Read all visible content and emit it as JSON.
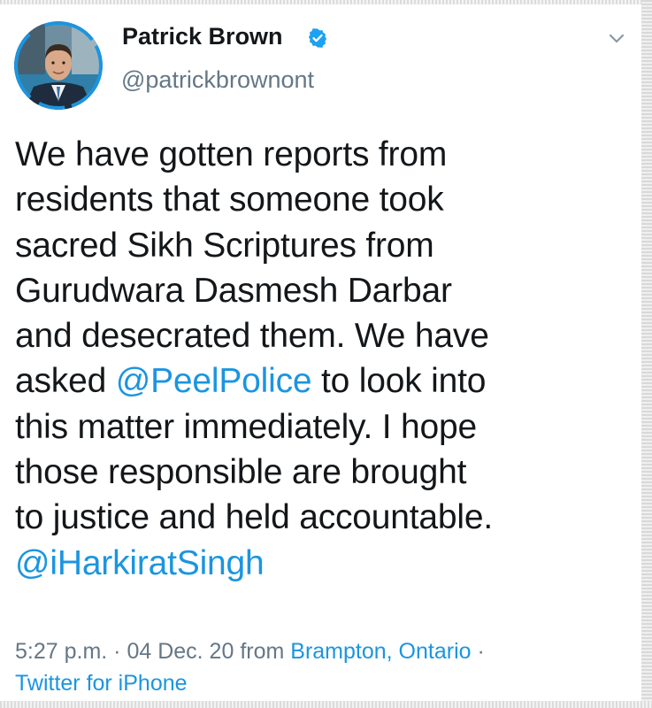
{
  "author": {
    "name": "Patrick Brown",
    "handle": "@patrickbrownont",
    "verified": true,
    "avatar_icon": "profile-photo"
  },
  "tweet": {
    "line1": "We have gotten reports from",
    "line2": "residents that someone took",
    "line3": "sacred Sikh Scriptures from",
    "line4": "Gurudwara Dasmesh Darbar",
    "line5": "and desecrated them. We have",
    "line6_before": "asked ",
    "mention1": "@PeelPolice",
    "line6_after": " to look into",
    "line7": "this matter immediately. I hope",
    "line8": "those responsible are brought",
    "line9": "to justice and held accountable.",
    "mention2": "@iHarkiratSingh"
  },
  "meta": {
    "time": "5:27 p.m.",
    "sep1": " · ",
    "date": "04 Dec. 20",
    "from_word": " from ",
    "location": "Brampton, Ontario",
    "sep2": " ·",
    "source": "Twitter for iPhone"
  },
  "colors": {
    "link": "#1b95e0",
    "text": "#14171a",
    "muted": "#657786",
    "verified": "#1da1f2"
  },
  "icons": {
    "verified": "verified-badge-icon",
    "menu": "chevron-down-icon"
  }
}
